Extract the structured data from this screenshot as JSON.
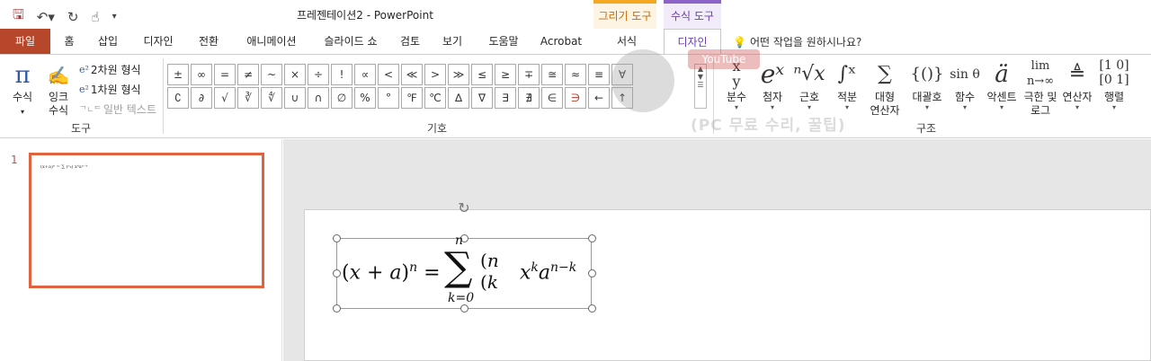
{
  "title_bar": {
    "document_title": "프레젠테이션2  -  PowerPoint",
    "qat_icons": [
      "save-icon",
      "undo-icon",
      "redo-icon",
      "touch-mode-icon",
      "customize-icon"
    ],
    "context_drawing": "그리기 도구",
    "context_equation": "수식 도구"
  },
  "tabs": {
    "file": "파일",
    "items": [
      "홈",
      "삽입",
      "디자인",
      "전환",
      "애니메이션",
      "슬라이드 쇼",
      "검토",
      "보기",
      "도움말",
      "Acrobat"
    ],
    "format": "서식",
    "design_active": "디자인",
    "tell_me": "어떤 작업을 원하시나요?"
  },
  "ribbon": {
    "tools": {
      "equation_label": "수식",
      "ink_label_1": "잉크",
      "ink_label_2": "수식",
      "professional": "2차원 형식",
      "linear": "1차원 형식",
      "normal_text": "일반 텍스트",
      "group_label": "도구"
    },
    "symbols": {
      "row1": [
        "±",
        "∞",
        "=",
        "≠",
        "~",
        "×",
        "÷",
        "!",
        "∝",
        "<",
        "≪",
        ">",
        "≫",
        "≤",
        "≥",
        "∓",
        "≅",
        "≈",
        "≡",
        "∀"
      ],
      "row2": [
        "∁",
        "∂",
        "√",
        "∛",
        "∜",
        "∪",
        "∩",
        "∅",
        "%",
        "°",
        "℉",
        "℃",
        "∆",
        "∇",
        "∃",
        "∄",
        "∈",
        "∋",
        "←",
        "↑"
      ],
      "group_label": "기호"
    },
    "structures": {
      "fraction": "분수",
      "script": "첨자",
      "radical": "근호",
      "integral": "적분",
      "large_op_1": "대형",
      "large_op_2": "연산자",
      "bracket": "대괄호",
      "function": "함수",
      "accent": "악센트",
      "limit_1": "극한 및",
      "limit_2": "로그",
      "operator": "연산자",
      "matrix": "행렬",
      "group_label": "구조"
    }
  },
  "watermark": {
    "yt": "YouTube",
    "text": "(PC 무료 수리, 꿀팁)"
  },
  "slides": {
    "number": "1"
  }
}
